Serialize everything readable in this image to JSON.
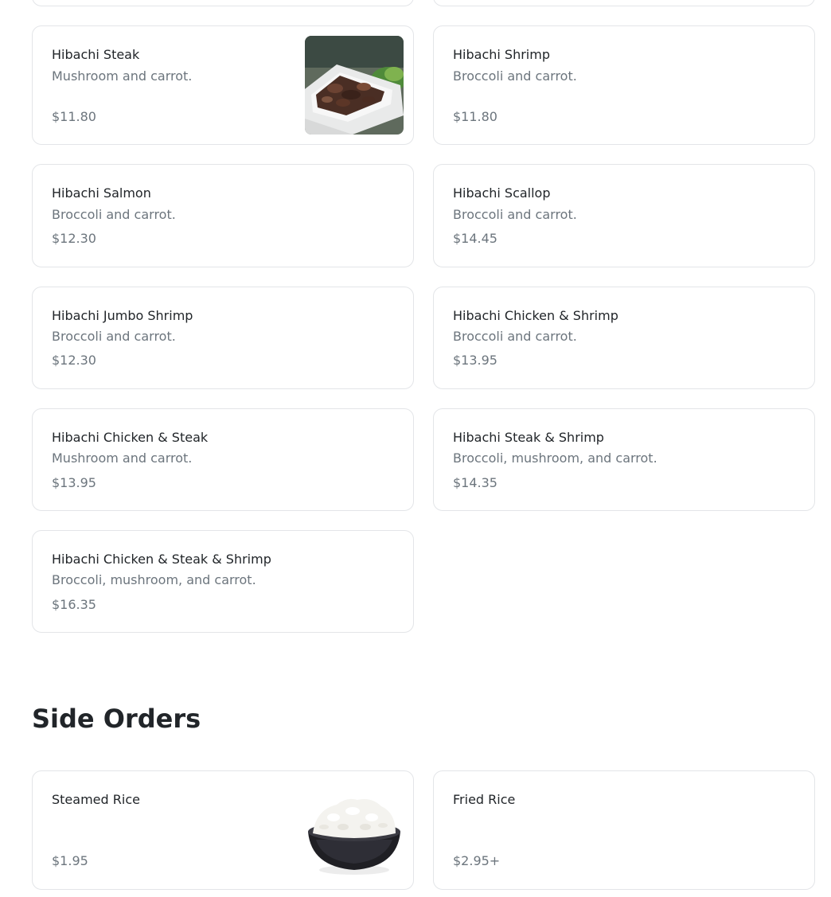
{
  "hibachi": {
    "items": [
      {
        "name": "Hibachi Steak",
        "desc": "Mushroom and carrot.",
        "price": "$11.80"
      },
      {
        "name": "Hibachi Shrimp",
        "desc": "Broccoli and carrot.",
        "price": "$11.80"
      },
      {
        "name": "Hibachi Salmon",
        "desc": "Broccoli and carrot.",
        "price": "$12.30"
      },
      {
        "name": "Hibachi Scallop",
        "desc": "Broccoli and carrot.",
        "price": "$14.45"
      },
      {
        "name": "Hibachi Jumbo Shrimp",
        "desc": "Broccoli and carrot.",
        "price": "$12.30"
      },
      {
        "name": "Hibachi Chicken & Shrimp",
        "desc": "Broccoli and carrot.",
        "price": "$13.95"
      },
      {
        "name": "Hibachi Chicken & Steak",
        "desc": "Mushroom and carrot.",
        "price": "$13.95"
      },
      {
        "name": "Hibachi Steak & Shrimp",
        "desc": "Broccoli, mushroom, and carrot.",
        "price": "$14.35"
      },
      {
        "name": "Hibachi Chicken & Steak & Shrimp",
        "desc": "Broccoli, mushroom, and carrot.",
        "price": "$16.35"
      }
    ]
  },
  "side_orders": {
    "title": "Side Orders",
    "items": [
      {
        "name": "Steamed Rice",
        "price": "$1.95"
      },
      {
        "name": "Fried Rice",
        "price": "$2.95+"
      }
    ]
  }
}
